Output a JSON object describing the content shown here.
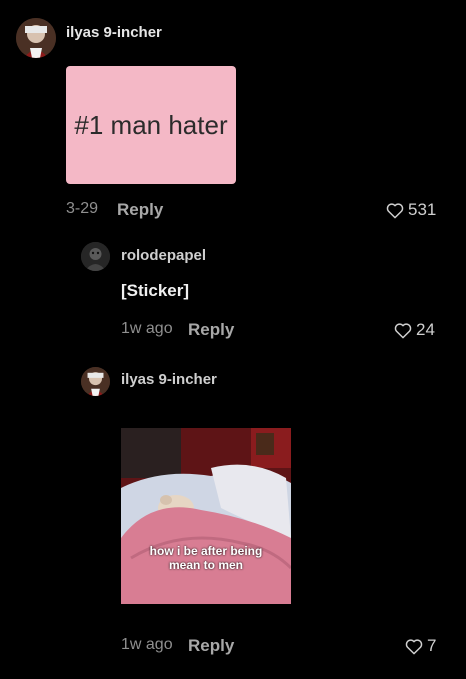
{
  "comments": {
    "main": {
      "username": "ilyas 9-incher",
      "sticker_text": "#1 man hater",
      "time": "3-29",
      "reply_label": "Reply",
      "likes": "531"
    },
    "reply1": {
      "username": "rolodepapel",
      "text": "[Sticker]",
      "time": "1w ago",
      "reply_label": "Reply",
      "likes": "24"
    },
    "reply2": {
      "username": "ilyas 9-incher",
      "gif_caption": "how i be after being mean to men",
      "time": "1w ago",
      "reply_label": "Reply",
      "likes": "7"
    }
  },
  "icons": {
    "heart": "heart-outline-icon"
  },
  "colors": {
    "background": "#000000",
    "sticker_pink": "#f4b8c6",
    "muted_text": "#8f8f8f"
  }
}
